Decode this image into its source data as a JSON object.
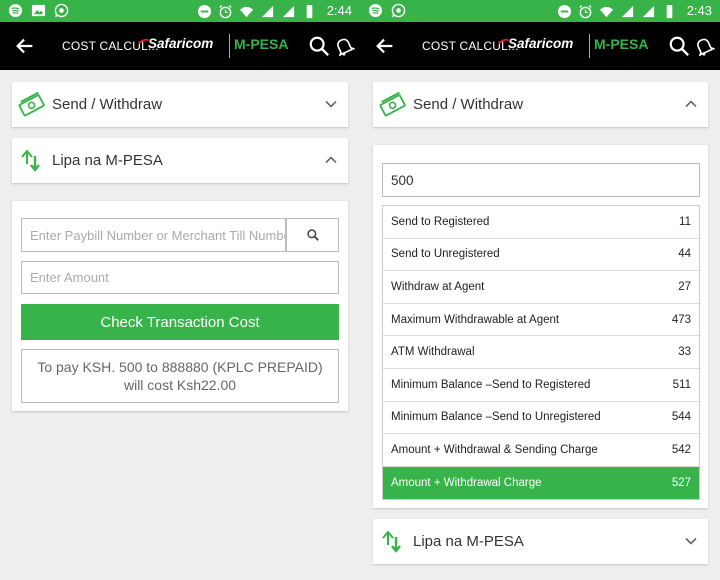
{
  "left": {
    "status_time": "2:44",
    "title": "COST CALCUL...",
    "brand_safaricom": "Safaricom",
    "brand_mpesa": "M-PESA",
    "send_withdraw_title": "Send / Withdraw",
    "lipa_title": "Lipa na M-PESA",
    "paybill_placeholder": "Enter Paybill Number or Merchant Till Number",
    "amount_placeholder": "Enter Amount",
    "check_button": "Check Transaction Cost",
    "result_line1": "To pay KSH. 500 to 888880 (KPLC PREPAID)",
    "result_line2": "will cost Ksh22.00"
  },
  "right": {
    "status_time": "2:43",
    "title": "COST CALCUL...",
    "brand_safaricom": "Safaricom",
    "brand_mpesa": "M-PESA",
    "send_withdraw_title": "Send / Withdraw",
    "amount_value": "500",
    "rows": [
      {
        "label": "Send to Registered",
        "value": "11"
      },
      {
        "label": "Send to Unregistered",
        "value": "44"
      },
      {
        "label": "Withdraw at Agent",
        "value": "27"
      },
      {
        "label": "Maximum Withdrawable at Agent",
        "value": "473"
      },
      {
        "label": "ATM Withdrawal",
        "value": "33"
      },
      {
        "label": "Minimum Balance –Send to Registered",
        "value": "511"
      },
      {
        "label": "Minimum Balance –Send to Unregistered",
        "value": "544"
      },
      {
        "label": "Amount + Withdrawal & Sending Charge",
        "value": "542"
      },
      {
        "label": "Amount + Withdrawal Charge",
        "value": "527"
      }
    ],
    "lipa_title": "Lipa na M-PESA"
  },
  "colors": {
    "accent_green": "#37b34a",
    "appbar_black": "#000000",
    "background": "#eeeeee"
  }
}
